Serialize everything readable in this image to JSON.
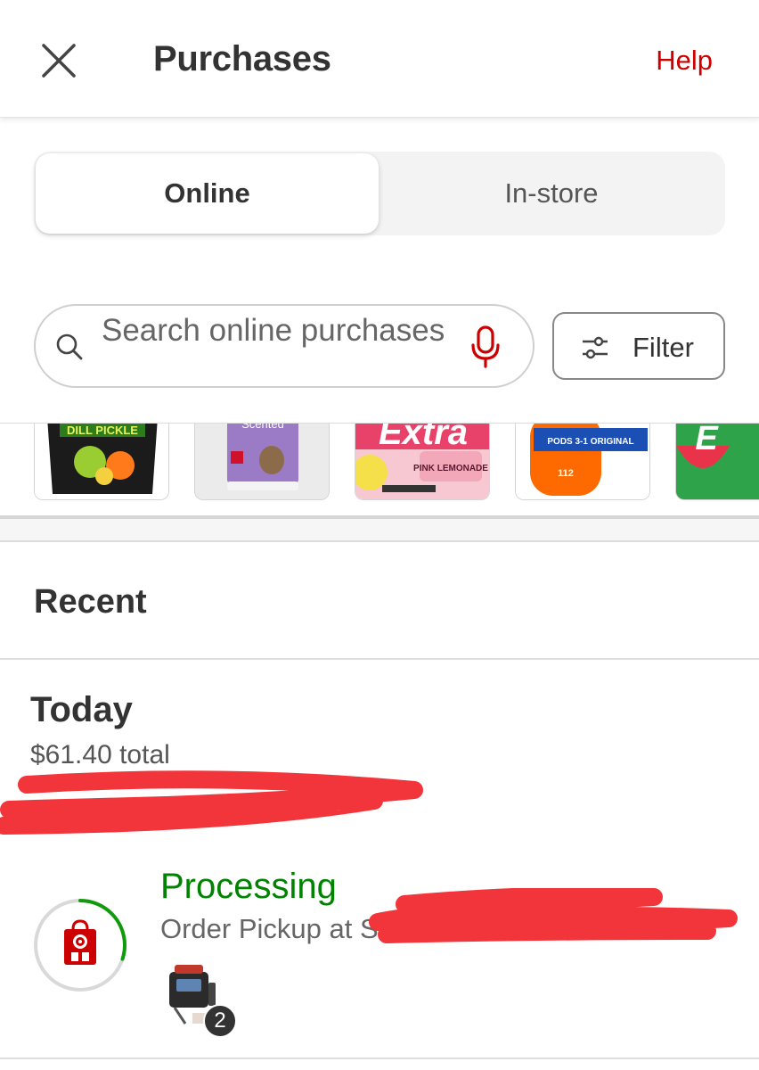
{
  "header": {
    "close_icon": "close-icon",
    "title": "Purchases",
    "help_label": "Help",
    "accent_color": "#cc0000"
  },
  "tabs": [
    {
      "label": "Online",
      "selected": true
    },
    {
      "label": "In-store",
      "selected": false
    }
  ],
  "search": {
    "placeholder": "Search online purchases",
    "icon": "search-icon",
    "mic_icon": "microphone-icon"
  },
  "filter": {
    "label": "Filter",
    "icon": "sliders-icon"
  },
  "product_strip": [
    {
      "name": "dill-pickle-chips",
      "text": "DILL PICKLE"
    },
    {
      "name": "scented-cat-litter",
      "text": "Scented"
    },
    {
      "name": "extra-gum-pink-lemonade",
      "text": "Extra",
      "subtext": "PINK LEMONADE"
    },
    {
      "name": "tide-pods",
      "text": "PODS 3-1 ORIGINAL",
      "count": "112"
    },
    {
      "name": "extra-gum-watermelon",
      "text": "E"
    }
  ],
  "recent": {
    "heading": "Recent"
  },
  "order": {
    "date_label": "Today",
    "total": "$61.40 total",
    "status": "Processing",
    "status_color": "#008300",
    "pickup_text": "Order Pickup at S",
    "item_count": "2",
    "progress_fraction": 0.3
  }
}
